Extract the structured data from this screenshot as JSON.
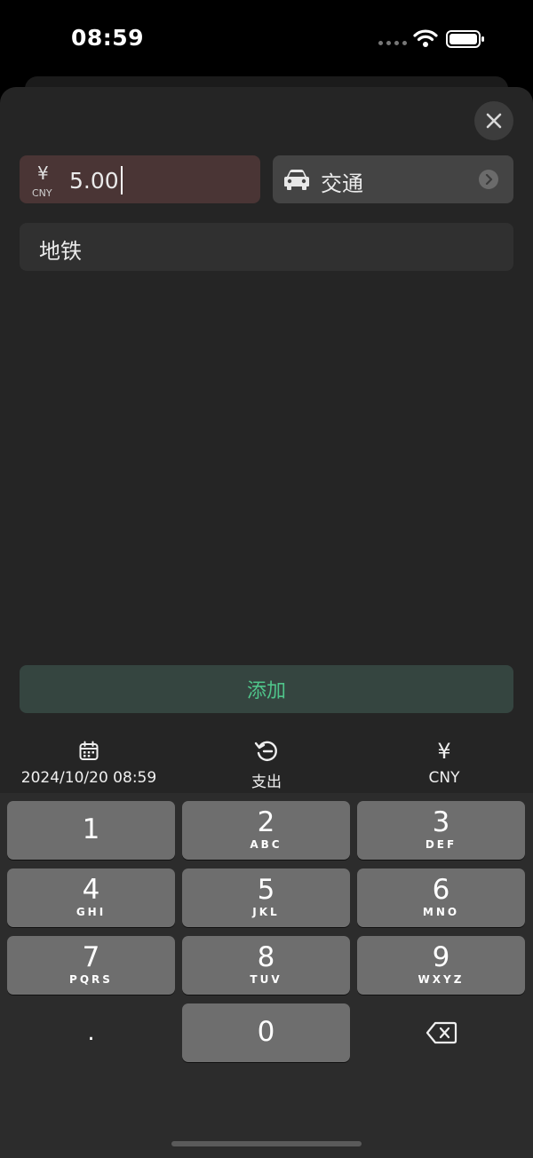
{
  "status": {
    "time": "08:59"
  },
  "form": {
    "currency_symbol": "¥",
    "currency_code": "CNY",
    "amount": "5.00",
    "category": "交通",
    "note": "地铁",
    "add_label": "添加"
  },
  "toolbar": {
    "date": "2024/10/20 08:59",
    "type": "支出",
    "currency_symbol": "¥",
    "currency": "CNY"
  },
  "keypad": {
    "keys": [
      {
        "digit": "1",
        "letters": ""
      },
      {
        "digit": "2",
        "letters": "ABC"
      },
      {
        "digit": "3",
        "letters": "DEF"
      },
      {
        "digit": "4",
        "letters": "GHI"
      },
      {
        "digit": "5",
        "letters": "JKL"
      },
      {
        "digit": "6",
        "letters": "MNO"
      },
      {
        "digit": "7",
        "letters": "PQRS"
      },
      {
        "digit": "8",
        "letters": "TUV"
      },
      {
        "digit": "9",
        "letters": "WXYZ"
      }
    ],
    "decimal": ".",
    "zero": "0"
  },
  "colors": {
    "accent_green": "#4fc48a",
    "amount_bg": "#4a3535",
    "sheet_bg": "#252525",
    "key_bg": "#6e6e6e"
  },
  "icons": [
    "wifi-icon",
    "battery-icon",
    "close-icon",
    "car-icon",
    "chevron-right-icon",
    "calendar-icon",
    "history-icon",
    "backspace-icon"
  ]
}
